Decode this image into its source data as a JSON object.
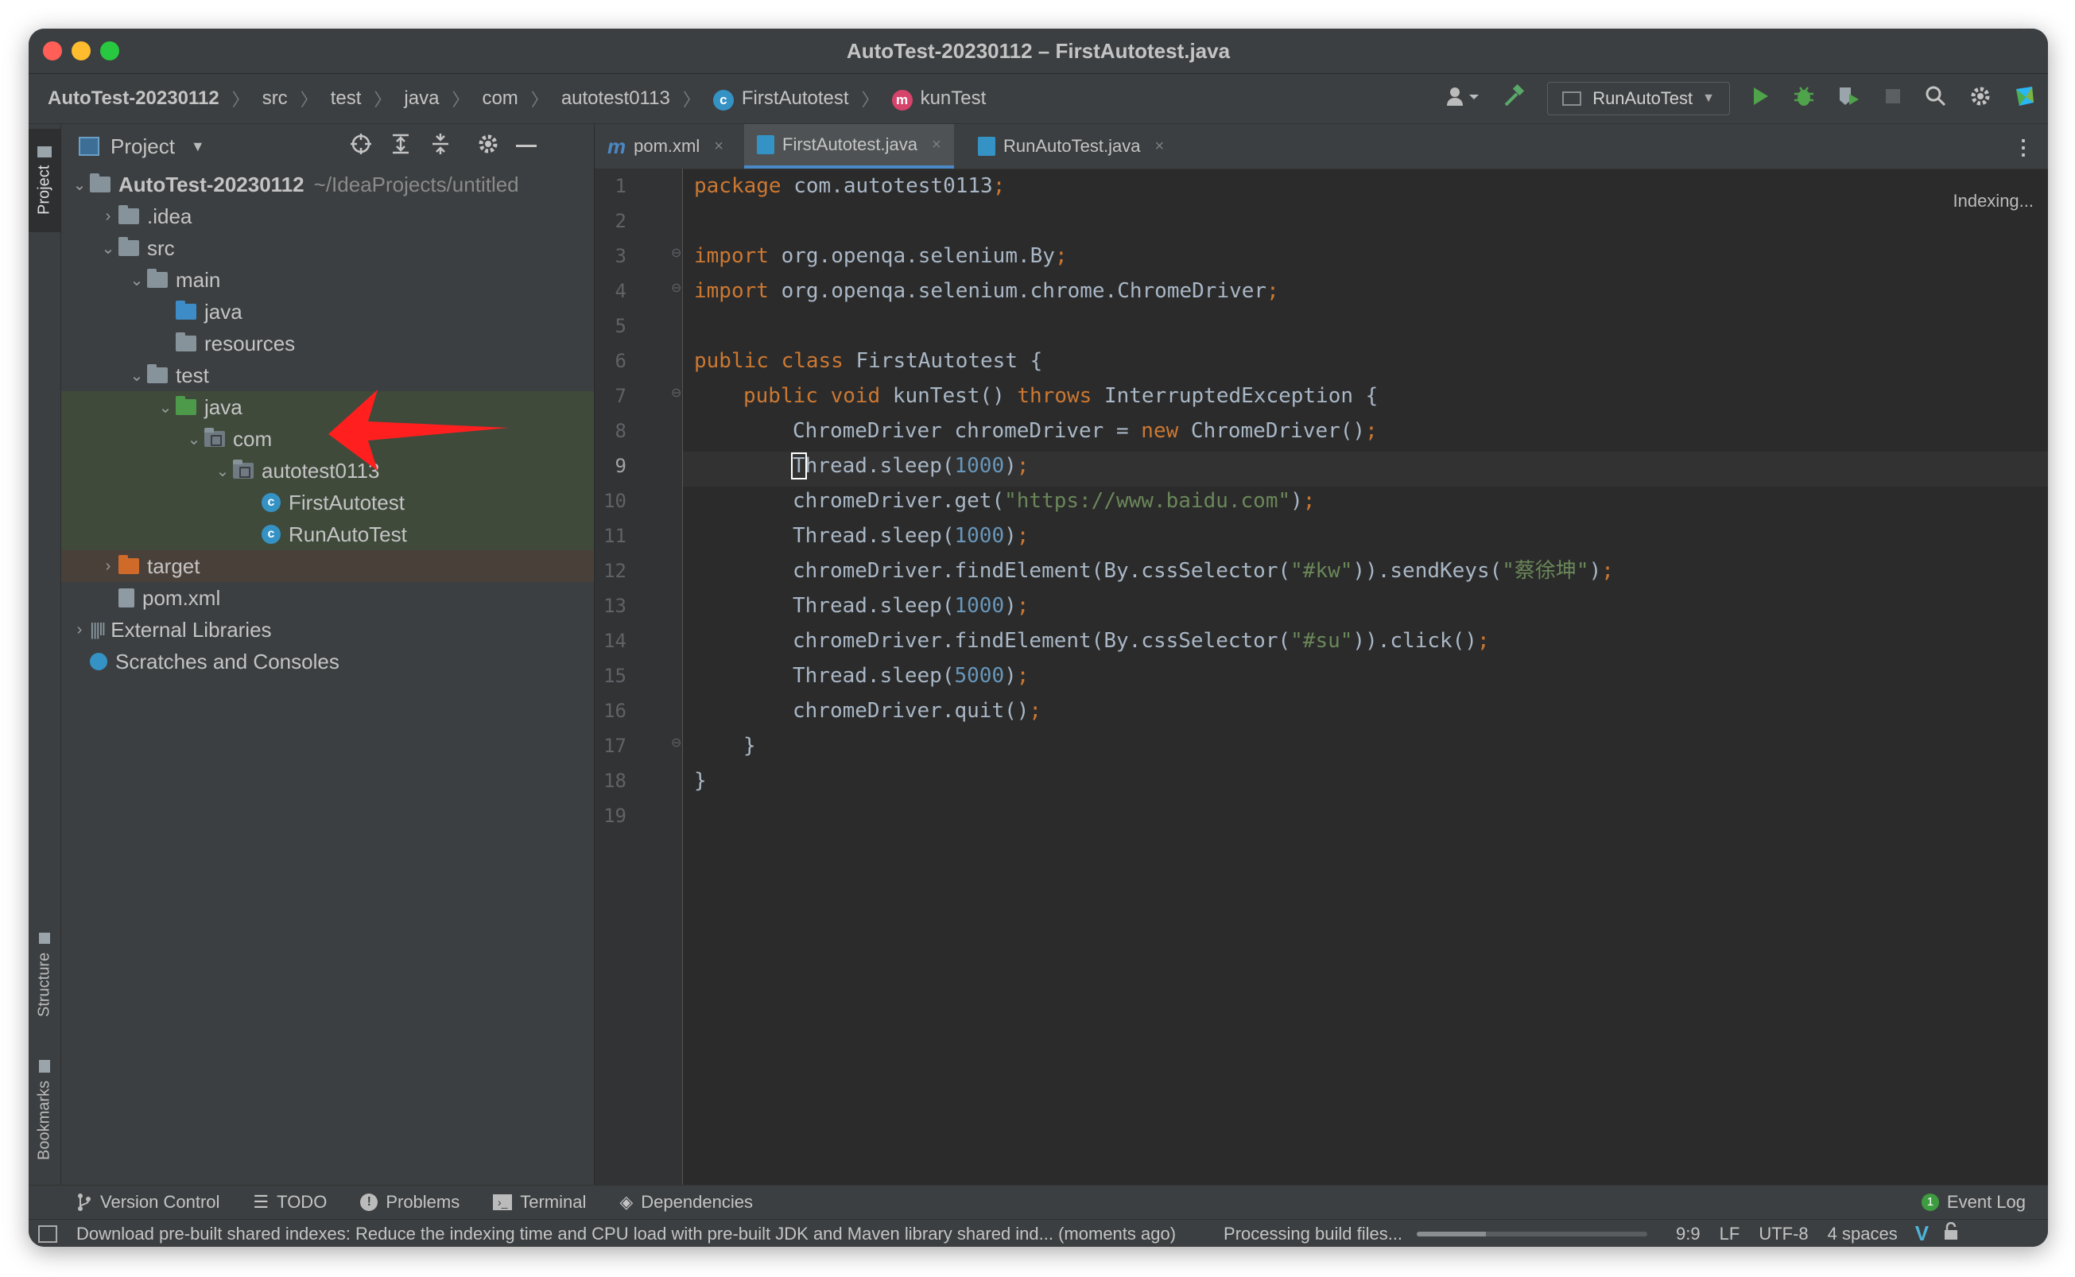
{
  "window": {
    "title": "AutoTest-20230112 – FirstAutotest.java"
  },
  "breadcrumb": {
    "project": "AutoTest-20230112",
    "parts": [
      "src",
      "test",
      "java",
      "com",
      "autotest0113"
    ],
    "class_name": "FirstAutotest",
    "method_name": "kunTest"
  },
  "toolbar": {
    "run_config": "RunAutoTest",
    "icons": [
      "user-icon",
      "hammer-icon",
      "run-icon",
      "debug-icon",
      "coverage-icon",
      "stop-icon",
      "search-icon",
      "gear-icon",
      "toolbox-icon"
    ]
  },
  "left_strip": {
    "project": "Project",
    "structure": "Structure",
    "bookmarks": "Bookmarks"
  },
  "project_panel": {
    "title": "Project",
    "tree": {
      "root_name": "AutoTest-20230112",
      "root_path": "~/IdeaProjects/untitled",
      "idea": ".idea",
      "src": "src",
      "main": "main",
      "main_java": "java",
      "resources": "resources",
      "test": "test",
      "test_java": "java",
      "com": "com",
      "package": "autotest0113",
      "class1": "FirstAutotest",
      "class2": "RunAutoTest",
      "target": "target",
      "pom": "pom.xml",
      "ext_libs": "External Libraries",
      "scratches": "Scratches and Consoles"
    }
  },
  "editor": {
    "tabs": [
      "pom.xml",
      "FirstAutotest.java",
      "RunAutoTest.java"
    ],
    "active_tab": "FirstAutotest.java",
    "status_hint": "Indexing...",
    "line_numbers": [
      "1",
      "2",
      "3",
      "4",
      "5",
      "6",
      "7",
      "8",
      "9",
      "10",
      "11",
      "12",
      "13",
      "14",
      "15",
      "16",
      "17",
      "18",
      "19"
    ],
    "caret_line": "9",
    "code": {
      "l1_kw": "package",
      "l1_rest": " com.autotest0113",
      "l3_kw": "import",
      "l3_rest": " org.openqa.selenium.By",
      "l4_kw": "import",
      "l4_rest": " org.openqa.selenium.chrome.ChromeDriver",
      "l6_kw": "public class",
      "l6_rest": " FirstAutotest {",
      "l7_kw1": "public void",
      "l7_mid": " kunTest() ",
      "l7_kw2": "throws",
      "l7_rest": " InterruptedException {",
      "l8_a": "ChromeDriver chromeDriver = ",
      "l8_kw": "new",
      "l8_b": " ChromeDriver()",
      "l9_a": "hread.sleep(",
      "l9_num": "1000",
      "l9_b": ")",
      "l10_a": "chromeDriver.get(",
      "l10_str": "\"https://www.baidu.com\"",
      "l10_b": ")",
      "l11_a": "Thread.sleep(",
      "l11_num": "1000",
      "l11_b": ")",
      "l12_a": "chromeDriver.findElement(By.cssSelector(",
      "l12_str1": "\"#kw\"",
      "l12_b": ")).sendKeys(",
      "l12_str2": "\"蔡徐坤\"",
      "l12_c": ")",
      "l13_a": "Thread.sleep(",
      "l13_num": "1000",
      "l13_b": ")",
      "l14_a": "chromeDriver.findElement(By.cssSelector(",
      "l14_str": "\"#su\"",
      "l14_b": ")).click()",
      "l15_a": "Thread.sleep(",
      "l15_num": "5000",
      "l15_b": ")",
      "l16_a": "chromeDriver.quit()",
      "l17": "}",
      "l18": "}",
      "semicolon": ";",
      "cursor_char": "T"
    }
  },
  "bottom_tools": {
    "version_control": "Version Control",
    "todo": "TODO",
    "problems": "Problems",
    "terminal": "Terminal",
    "dependencies": "Dependencies",
    "event_log": "Event Log",
    "event_count": "1"
  },
  "status_bar": {
    "message": "Download pre-built shared indexes: Reduce the indexing time and CPU load with pre-built JDK and Maven library shared ind... (moments ago)",
    "processing": "Processing build files...",
    "progress": 0.3,
    "position": "9:9",
    "line_sep": "LF",
    "encoding": "UTF-8",
    "indent": "4 spaces"
  },
  "colors": {
    "keyword": "#cc7832",
    "string": "#6a8759",
    "number": "#6897bb",
    "accent": "#4a88c7",
    "arrow": "#ff1f1f"
  }
}
